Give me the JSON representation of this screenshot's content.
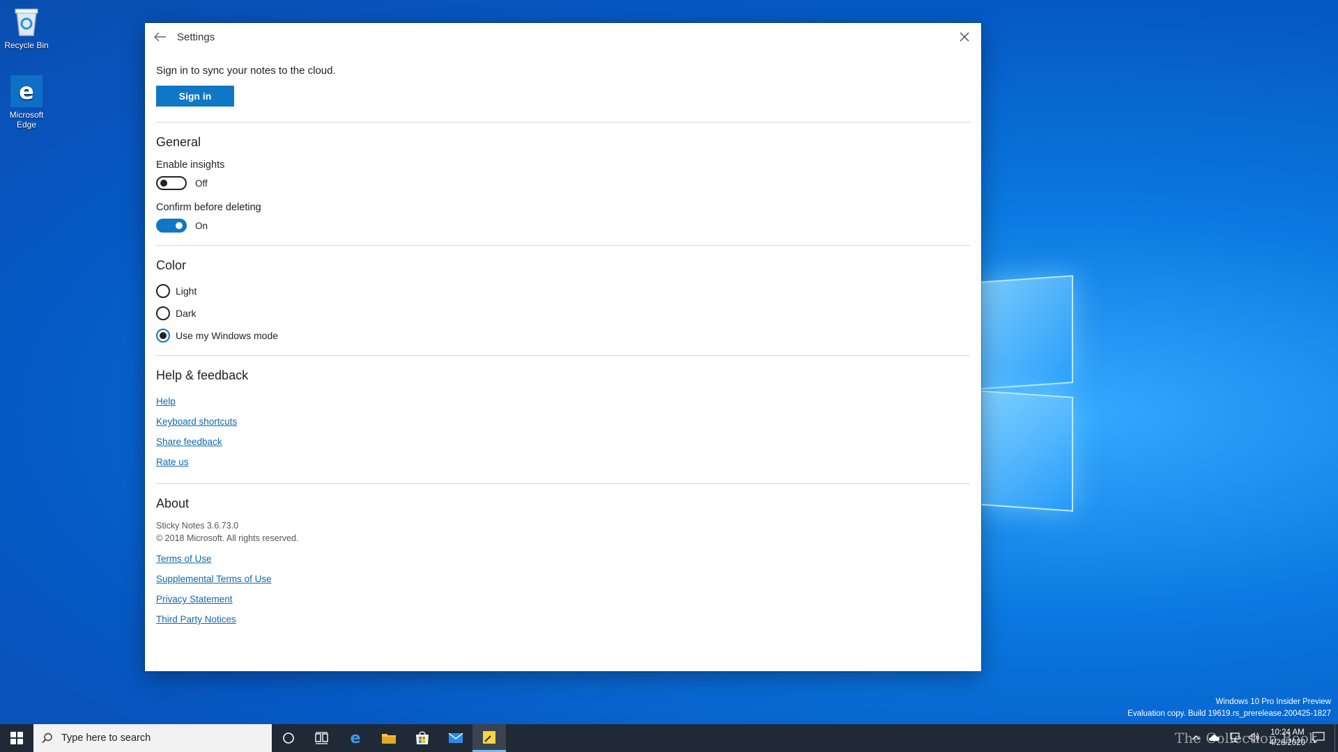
{
  "desktop": {
    "recycle_bin_label": "Recycle Bin",
    "edge_label": "Microsoft Edge"
  },
  "window": {
    "title": "Settings",
    "sync_text": "Sign in to sync your notes to the cloud.",
    "sign_in_label": "Sign in"
  },
  "general": {
    "heading": "General",
    "insights_label": "Enable insights",
    "insights_state": "Off",
    "confirm_label": "Confirm before deleting",
    "confirm_state": "On"
  },
  "color": {
    "heading": "Color",
    "options": [
      "Light",
      "Dark",
      "Use my Windows mode"
    ],
    "selected": "Use my Windows mode"
  },
  "help": {
    "heading": "Help & feedback",
    "links": [
      "Help",
      "Keyboard shortcuts",
      "Share feedback",
      "Rate us"
    ]
  },
  "about": {
    "heading": "About",
    "version": "Sticky Notes 3.6.73.0",
    "copyright": "© 2018 Microsoft. All rights reserved.",
    "links": [
      "Terms of Use",
      "Supplemental Terms of Use",
      "Privacy Statement",
      "Third Party Notices"
    ]
  },
  "taskbar": {
    "search_placeholder": "Type here to search",
    "time": "10:24 AM",
    "date": "4/26/2020"
  },
  "watermark": {
    "line1": "Windows 10 Pro Insider Preview",
    "line2": "Evaluation copy. Build 19619.rs_prerelease.200425-1827",
    "overlay": "The Collection Book"
  },
  "colors": {
    "accent": "#0f78c6",
    "link": "#0f68b0",
    "taskbar": "#1f2a36"
  }
}
